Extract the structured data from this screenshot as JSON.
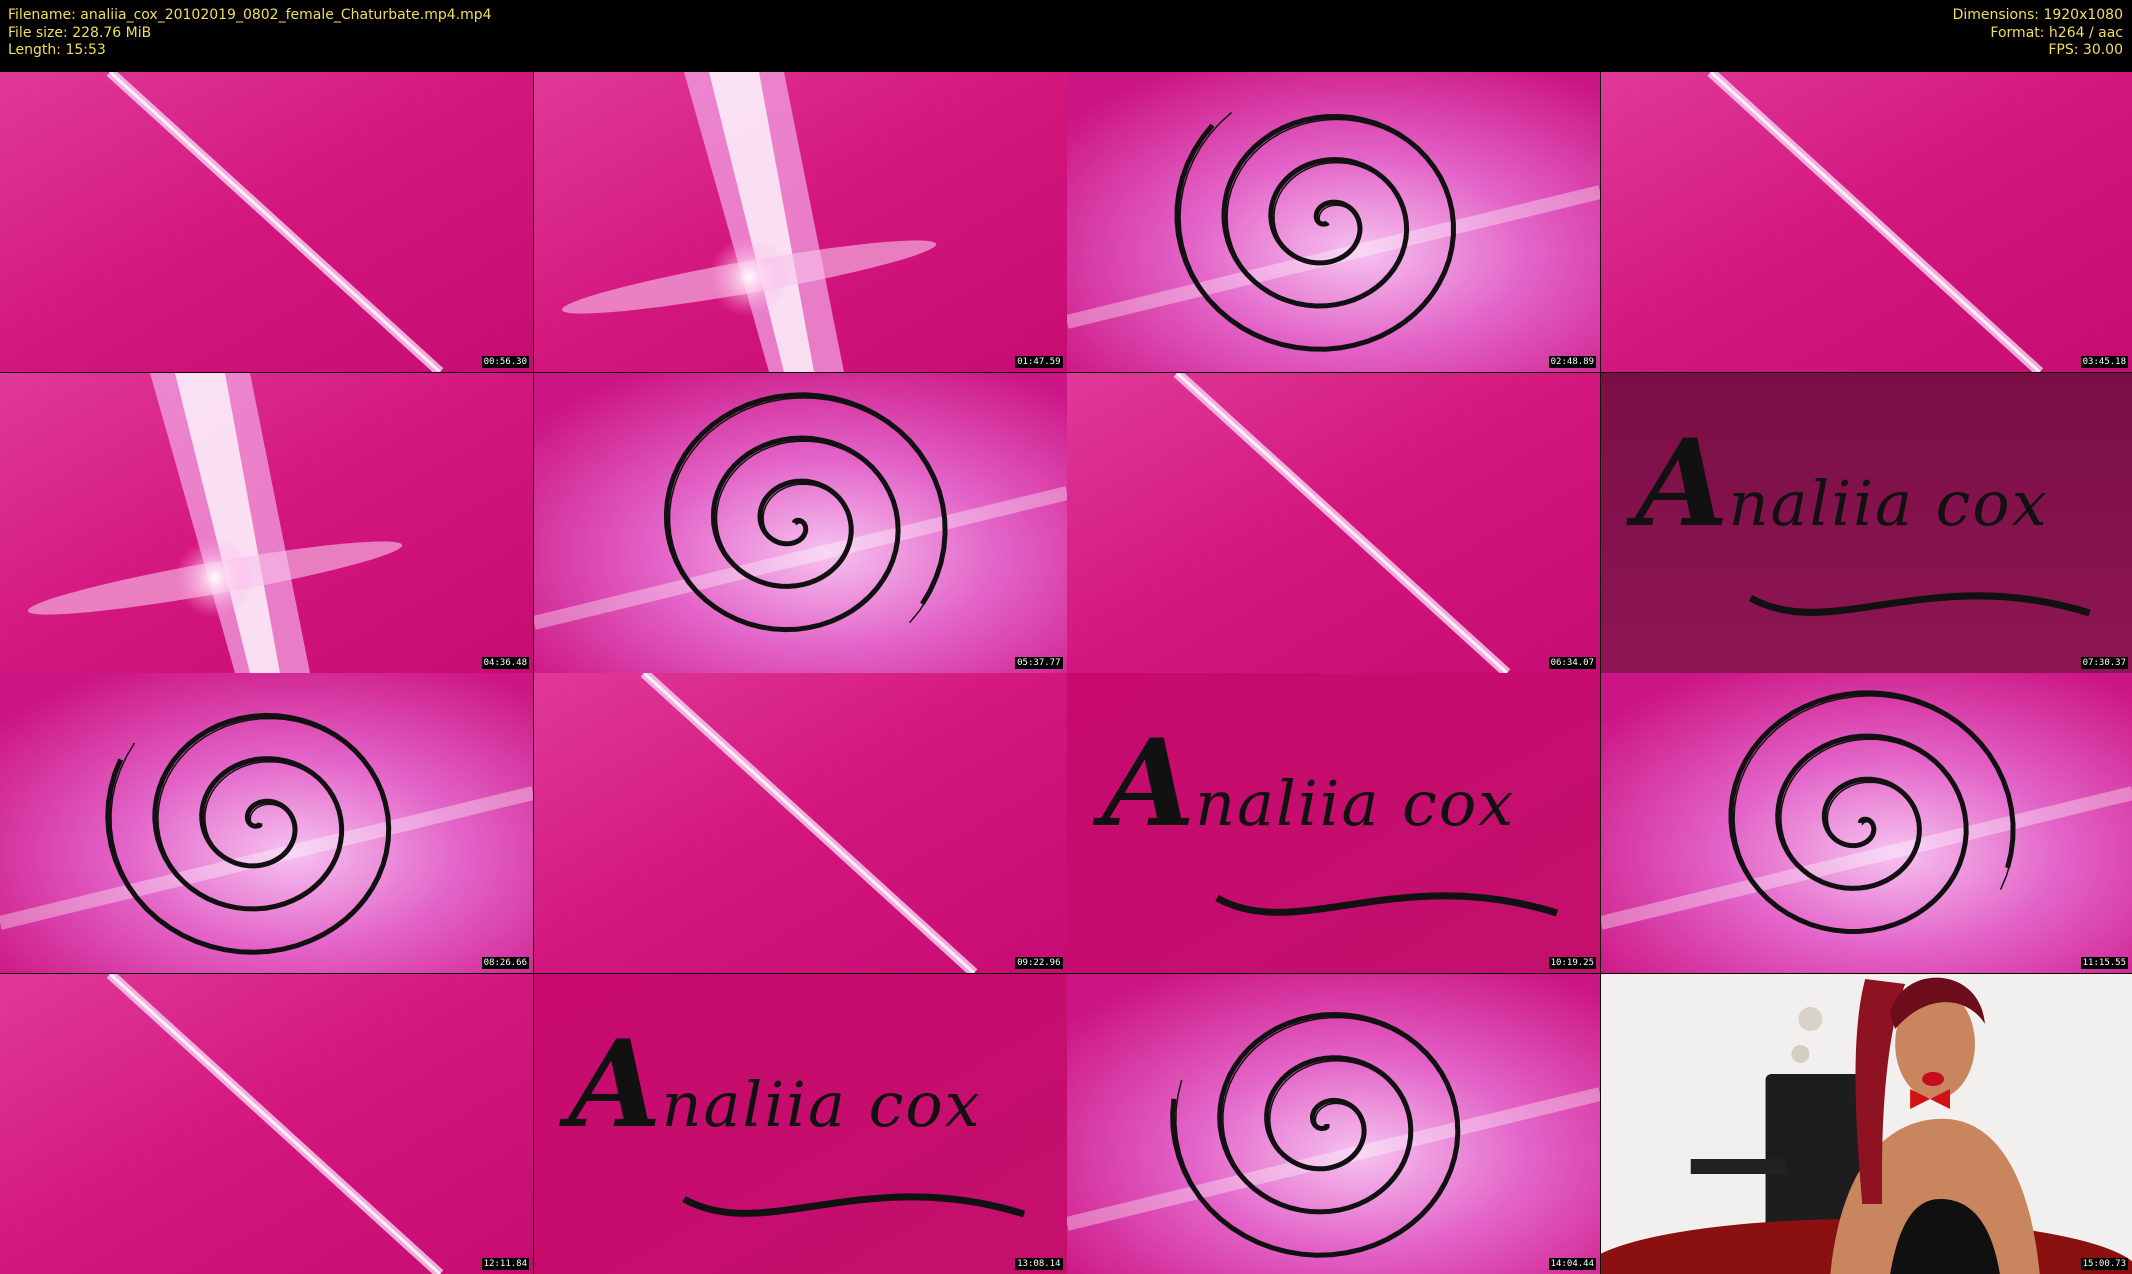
{
  "header": {
    "filename": "Filename: analiia_cox_20102019_0802_female_Chaturbate.mp4.mp4",
    "filesize": "File size: 228.76 MiB",
    "length": "Length: 15:53",
    "dimensions": "Dimensions: 1920x1080",
    "format": "Format: h264 / aac",
    "fps": "FPS: 30.00"
  },
  "colors": {
    "header_text": "#f2dd60",
    "pink": "#d8137f",
    "deep_pink": "#7a0f45"
  },
  "tiles": [
    {
      "time": "00:56.30",
      "kind": "rays"
    },
    {
      "time": "01:47.59",
      "kind": "beam"
    },
    {
      "time": "02:48.89",
      "kind": "swirl"
    },
    {
      "time": "03:45.18",
      "kind": "rays"
    },
    {
      "time": "04:36.48",
      "kind": "beam"
    },
    {
      "time": "05:37.77",
      "kind": "swirl"
    },
    {
      "time": "06:34.07",
      "kind": "rays"
    },
    {
      "time": "07:30.37",
      "kind": "logo"
    },
    {
      "time": "08:26.66",
      "kind": "swirl"
    },
    {
      "time": "09:22.96",
      "kind": "rays"
    },
    {
      "time": "10:19.25",
      "kind": "logo"
    },
    {
      "time": "11:15.55",
      "kind": "swirl"
    },
    {
      "time": "12:11.84",
      "kind": "rays"
    },
    {
      "time": "13:08.14",
      "kind": "logo"
    },
    {
      "time": "14:04.44",
      "kind": "swirl"
    },
    {
      "time": "15:00.73",
      "kind": "webcam"
    }
  ],
  "logo": {
    "initial": "A",
    "rest": "naliia cox"
  }
}
